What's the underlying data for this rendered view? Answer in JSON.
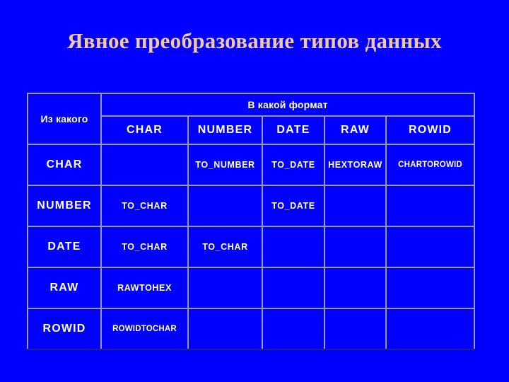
{
  "slide": {
    "title": "Явное преобразование типов данных",
    "background_color": "#0000FF",
    "title_color": "#F2C9A8"
  },
  "table": {
    "corner_label": "Из какого",
    "column_group_label": "В какой формат",
    "label_color": "#E01B10",
    "function_text_color": "#FFFFCC",
    "header_text_color": "#FFFFFF",
    "disabled_cell_color": "#C0C0C0",
    "columns": [
      "CHAR",
      "NUMBER",
      "DATE",
      "RAW",
      "ROWID"
    ],
    "rows": [
      {
        "label": "CHAR",
        "cells": [
          {
            "text": "",
            "state": "self"
          },
          {
            "text": "TO_NUMBER",
            "state": "value"
          },
          {
            "text": "TO_DATE",
            "state": "value"
          },
          {
            "text": "HEXTORAW",
            "state": "value"
          },
          {
            "text": "CHARTOROWID",
            "state": "value"
          }
        ]
      },
      {
        "label": "NUMBER",
        "cells": [
          {
            "text": "TO_CHAR",
            "state": "value"
          },
          {
            "text": "",
            "state": "self"
          },
          {
            "text": "TO_DATE",
            "state": "value"
          },
          {
            "text": "",
            "state": "empty"
          },
          {
            "text": "",
            "state": "empty"
          }
        ]
      },
      {
        "label": "DATE",
        "cells": [
          {
            "text": "TO_CHAR",
            "state": "value"
          },
          {
            "text": "TO_CHAR",
            "state": "value"
          },
          {
            "text": "",
            "state": "self"
          },
          {
            "text": "",
            "state": "empty"
          },
          {
            "text": "",
            "state": "empty"
          }
        ]
      },
      {
        "label": "RAW",
        "cells": [
          {
            "text": "RAWTOHEX",
            "state": "value"
          },
          {
            "text": "",
            "state": "empty"
          },
          {
            "text": "",
            "state": "empty"
          },
          {
            "text": "",
            "state": "self"
          },
          {
            "text": "",
            "state": "empty"
          }
        ]
      },
      {
        "label": "ROWID",
        "cells": [
          {
            "text": "ROWIDTOCHAR",
            "state": "value"
          },
          {
            "text": "",
            "state": "empty"
          },
          {
            "text": "",
            "state": "empty"
          },
          {
            "text": "",
            "state": "empty"
          },
          {
            "text": "",
            "state": "self"
          }
        ]
      }
    ]
  }
}
